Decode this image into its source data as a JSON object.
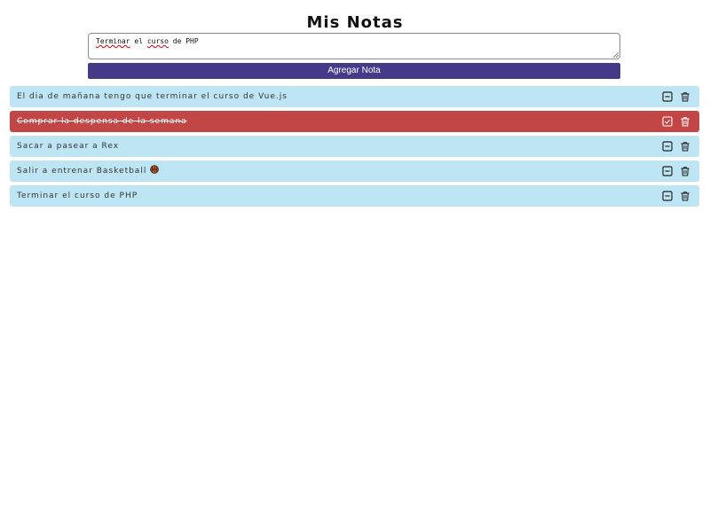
{
  "header": {
    "title": "Mis Notas"
  },
  "form": {
    "input_value": "Terminar el curso de PHP",
    "input_words": [
      {
        "text": "Terminar",
        "misspelled": true
      },
      {
        "text": "el",
        "misspelled": false
      },
      {
        "text": "curso",
        "misspelled": true
      },
      {
        "text": "de",
        "misspelled": false
      },
      {
        "text": "PHP",
        "misspelled": false
      }
    ],
    "add_button_label": "Agregar Nota"
  },
  "notes": [
    {
      "text": "El dia de mañana tengo que terminar el curso de Vue.js",
      "done": false,
      "emoji": ""
    },
    {
      "text": "Comprar la despensa de la semana",
      "done": true,
      "emoji": ""
    },
    {
      "text": "Sacar a pasear a Rex",
      "done": false,
      "emoji": ""
    },
    {
      "text": "Salir a entrenar Basketball",
      "done": false,
      "emoji": "🏀"
    },
    {
      "text": "Terminar el curso de PHP",
      "done": false,
      "emoji": ""
    }
  ],
  "icons": {
    "toggle_undone": "minus-square-icon",
    "toggle_done": "check-square-icon",
    "delete": "trash-icon"
  },
  "colors": {
    "accent": "#433b8a",
    "note_bg": "#bee5f4",
    "note_done_bg": "#c24646"
  }
}
